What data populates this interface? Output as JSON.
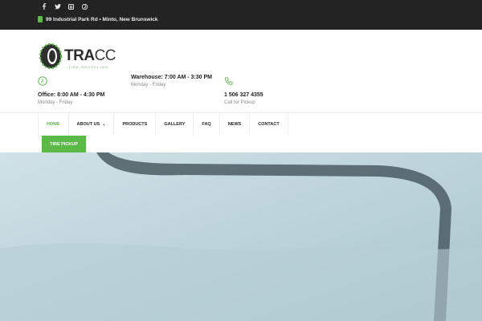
{
  "topbar": {
    "social": [
      {
        "name": "facebook-icon",
        "glyph": "f"
      },
      {
        "name": "twitter-icon",
        "glyph": "t"
      },
      {
        "name": "instagram-icon",
        "glyph": "i"
      },
      {
        "name": "pinterest-icon",
        "glyph": "p"
      }
    ],
    "address": "99 Industrial Park Rd • Minto, New Brunswick"
  },
  "logo": {
    "brand_main": "TRA",
    "brand_cc": "CC",
    "brand_sub": "TIRE RECYCLING"
  },
  "info": {
    "office": {
      "title": "Office: 8:00 AM - 4:30 PM",
      "sub": "Monday - Friday"
    },
    "warehouse": {
      "title": "Warehouse: 7:00 AM - 3:30 PM",
      "sub": "Monday - Friday"
    },
    "phone": {
      "title": "1 506 327 4355",
      "sub": "Call for Pickup"
    }
  },
  "nav": {
    "items": [
      "HOME",
      "ABOUT US",
      "PRODUCTS",
      "GALLERY",
      "FAQ",
      "NEWS",
      "CONTACT"
    ],
    "pickup": "TIRE PICKUP"
  },
  "colors": {
    "accent": "#5ab947",
    "topbar": "#232323"
  }
}
